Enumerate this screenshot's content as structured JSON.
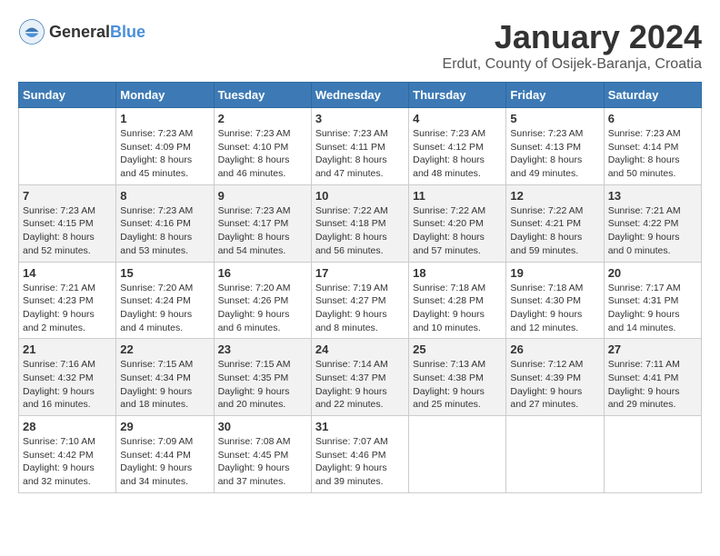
{
  "header": {
    "logo_general": "General",
    "logo_blue": "Blue",
    "month_title": "January 2024",
    "location": "Erdut, County of Osijek-Baranja, Croatia"
  },
  "weekdays": [
    "Sunday",
    "Monday",
    "Tuesday",
    "Wednesday",
    "Thursday",
    "Friday",
    "Saturday"
  ],
  "weeks": [
    [
      {
        "day": "",
        "sunrise": "",
        "sunset": "",
        "daylight": ""
      },
      {
        "day": "1",
        "sunrise": "Sunrise: 7:23 AM",
        "sunset": "Sunset: 4:09 PM",
        "daylight": "Daylight: 8 hours and 45 minutes."
      },
      {
        "day": "2",
        "sunrise": "Sunrise: 7:23 AM",
        "sunset": "Sunset: 4:10 PM",
        "daylight": "Daylight: 8 hours and 46 minutes."
      },
      {
        "day": "3",
        "sunrise": "Sunrise: 7:23 AM",
        "sunset": "Sunset: 4:11 PM",
        "daylight": "Daylight: 8 hours and 47 minutes."
      },
      {
        "day": "4",
        "sunrise": "Sunrise: 7:23 AM",
        "sunset": "Sunset: 4:12 PM",
        "daylight": "Daylight: 8 hours and 48 minutes."
      },
      {
        "day": "5",
        "sunrise": "Sunrise: 7:23 AM",
        "sunset": "Sunset: 4:13 PM",
        "daylight": "Daylight: 8 hours and 49 minutes."
      },
      {
        "day": "6",
        "sunrise": "Sunrise: 7:23 AM",
        "sunset": "Sunset: 4:14 PM",
        "daylight": "Daylight: 8 hours and 50 minutes."
      }
    ],
    [
      {
        "day": "7",
        "sunrise": "Sunrise: 7:23 AM",
        "sunset": "Sunset: 4:15 PM",
        "daylight": "Daylight: 8 hours and 52 minutes."
      },
      {
        "day": "8",
        "sunrise": "Sunrise: 7:23 AM",
        "sunset": "Sunset: 4:16 PM",
        "daylight": "Daylight: 8 hours and 53 minutes."
      },
      {
        "day": "9",
        "sunrise": "Sunrise: 7:23 AM",
        "sunset": "Sunset: 4:17 PM",
        "daylight": "Daylight: 8 hours and 54 minutes."
      },
      {
        "day": "10",
        "sunrise": "Sunrise: 7:22 AM",
        "sunset": "Sunset: 4:18 PM",
        "daylight": "Daylight: 8 hours and 56 minutes."
      },
      {
        "day": "11",
        "sunrise": "Sunrise: 7:22 AM",
        "sunset": "Sunset: 4:20 PM",
        "daylight": "Daylight: 8 hours and 57 minutes."
      },
      {
        "day": "12",
        "sunrise": "Sunrise: 7:22 AM",
        "sunset": "Sunset: 4:21 PM",
        "daylight": "Daylight: 8 hours and 59 minutes."
      },
      {
        "day": "13",
        "sunrise": "Sunrise: 7:21 AM",
        "sunset": "Sunset: 4:22 PM",
        "daylight": "Daylight: 9 hours and 0 minutes."
      }
    ],
    [
      {
        "day": "14",
        "sunrise": "Sunrise: 7:21 AM",
        "sunset": "Sunset: 4:23 PM",
        "daylight": "Daylight: 9 hours and 2 minutes."
      },
      {
        "day": "15",
        "sunrise": "Sunrise: 7:20 AM",
        "sunset": "Sunset: 4:24 PM",
        "daylight": "Daylight: 9 hours and 4 minutes."
      },
      {
        "day": "16",
        "sunrise": "Sunrise: 7:20 AM",
        "sunset": "Sunset: 4:26 PM",
        "daylight": "Daylight: 9 hours and 6 minutes."
      },
      {
        "day": "17",
        "sunrise": "Sunrise: 7:19 AM",
        "sunset": "Sunset: 4:27 PM",
        "daylight": "Daylight: 9 hours and 8 minutes."
      },
      {
        "day": "18",
        "sunrise": "Sunrise: 7:18 AM",
        "sunset": "Sunset: 4:28 PM",
        "daylight": "Daylight: 9 hours and 10 minutes."
      },
      {
        "day": "19",
        "sunrise": "Sunrise: 7:18 AM",
        "sunset": "Sunset: 4:30 PM",
        "daylight": "Daylight: 9 hours and 12 minutes."
      },
      {
        "day": "20",
        "sunrise": "Sunrise: 7:17 AM",
        "sunset": "Sunset: 4:31 PM",
        "daylight": "Daylight: 9 hours and 14 minutes."
      }
    ],
    [
      {
        "day": "21",
        "sunrise": "Sunrise: 7:16 AM",
        "sunset": "Sunset: 4:32 PM",
        "daylight": "Daylight: 9 hours and 16 minutes."
      },
      {
        "day": "22",
        "sunrise": "Sunrise: 7:15 AM",
        "sunset": "Sunset: 4:34 PM",
        "daylight": "Daylight: 9 hours and 18 minutes."
      },
      {
        "day": "23",
        "sunrise": "Sunrise: 7:15 AM",
        "sunset": "Sunset: 4:35 PM",
        "daylight": "Daylight: 9 hours and 20 minutes."
      },
      {
        "day": "24",
        "sunrise": "Sunrise: 7:14 AM",
        "sunset": "Sunset: 4:37 PM",
        "daylight": "Daylight: 9 hours and 22 minutes."
      },
      {
        "day": "25",
        "sunrise": "Sunrise: 7:13 AM",
        "sunset": "Sunset: 4:38 PM",
        "daylight": "Daylight: 9 hours and 25 minutes."
      },
      {
        "day": "26",
        "sunrise": "Sunrise: 7:12 AM",
        "sunset": "Sunset: 4:39 PM",
        "daylight": "Daylight: 9 hours and 27 minutes."
      },
      {
        "day": "27",
        "sunrise": "Sunrise: 7:11 AM",
        "sunset": "Sunset: 4:41 PM",
        "daylight": "Daylight: 9 hours and 29 minutes."
      }
    ],
    [
      {
        "day": "28",
        "sunrise": "Sunrise: 7:10 AM",
        "sunset": "Sunset: 4:42 PM",
        "daylight": "Daylight: 9 hours and 32 minutes."
      },
      {
        "day": "29",
        "sunrise": "Sunrise: 7:09 AM",
        "sunset": "Sunset: 4:44 PM",
        "daylight": "Daylight: 9 hours and 34 minutes."
      },
      {
        "day": "30",
        "sunrise": "Sunrise: 7:08 AM",
        "sunset": "Sunset: 4:45 PM",
        "daylight": "Daylight: 9 hours and 37 minutes."
      },
      {
        "day": "31",
        "sunrise": "Sunrise: 7:07 AM",
        "sunset": "Sunset: 4:46 PM",
        "daylight": "Daylight: 9 hours and 39 minutes."
      },
      {
        "day": "",
        "sunrise": "",
        "sunset": "",
        "daylight": ""
      },
      {
        "day": "",
        "sunrise": "",
        "sunset": "",
        "daylight": ""
      },
      {
        "day": "",
        "sunrise": "",
        "sunset": "",
        "daylight": ""
      }
    ]
  ]
}
